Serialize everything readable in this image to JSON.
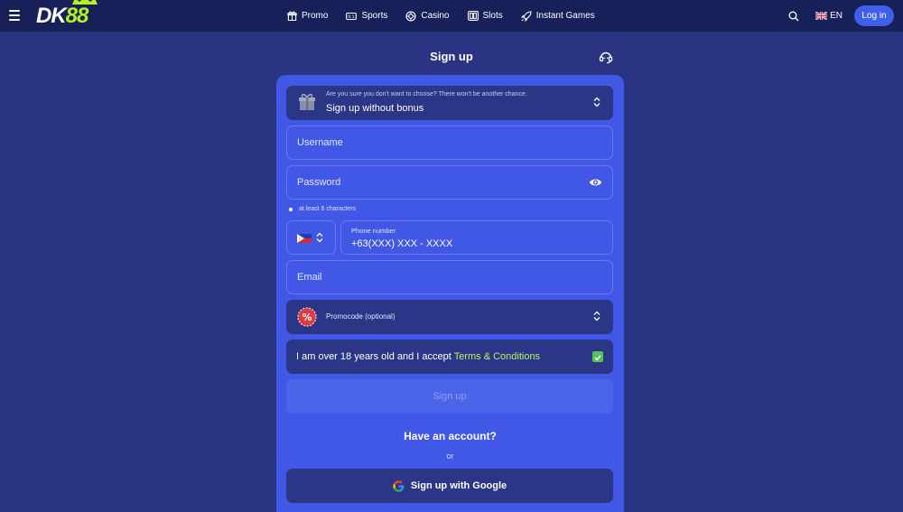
{
  "brand": {
    "logo_main": "DK",
    "logo_accent": "88",
    "accent_color": "#b4f11f"
  },
  "nav": {
    "items": [
      {
        "label": "Promo",
        "icon": "gift-icon"
      },
      {
        "label": "Sports",
        "icon": "ticket-icon"
      },
      {
        "label": "Casino",
        "icon": "chip-icon"
      },
      {
        "label": "Slots",
        "icon": "slots-icon"
      },
      {
        "label": "Instant Games",
        "icon": "rocket-icon"
      }
    ]
  },
  "header": {
    "language": "EN",
    "login_label": "Log in"
  },
  "signup": {
    "title": "Sign up",
    "bonus": {
      "hint": "Are you sure you don't want to choose? There won't be another chance.",
      "value": "Sign up without bonus"
    },
    "username_placeholder": "Username",
    "password_placeholder": "Password",
    "password_hint": "at least 6 characters",
    "phone": {
      "country": "PH",
      "label": "Phone number",
      "value": "+63(XXX) XXX - XXXX"
    },
    "email_placeholder": "Email",
    "promocode_label": "Promocode (optional)",
    "terms": {
      "prefix": "I am over 18 years old and I accept ",
      "link": "Terms & Conditions",
      "checked": true
    },
    "submit_label": "Sign up",
    "have_account": "Have an account?",
    "or": "or",
    "google_label": "Sign up with Google"
  }
}
